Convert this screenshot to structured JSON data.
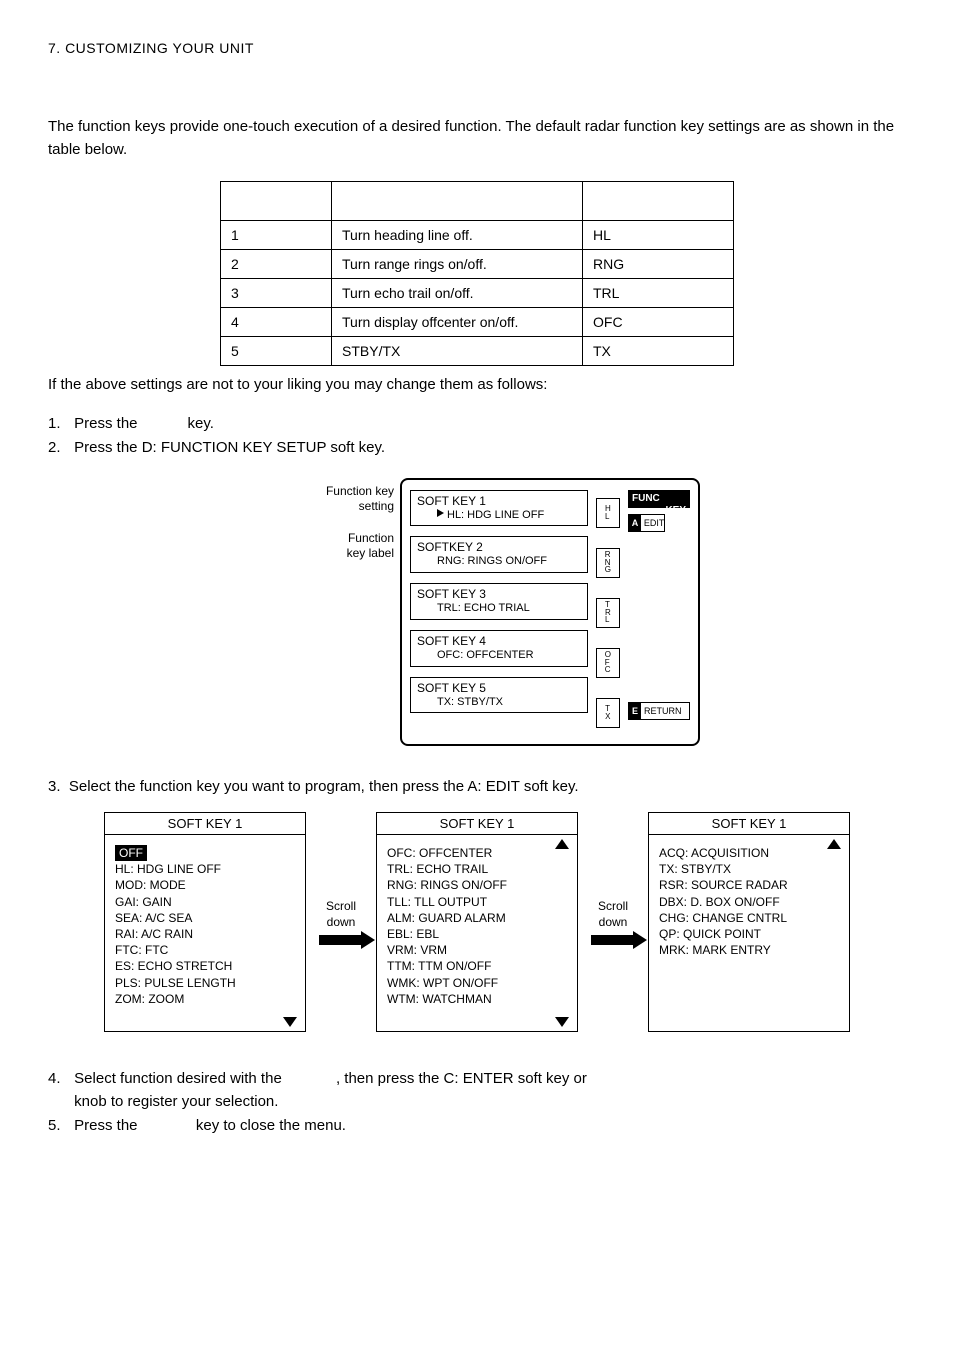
{
  "page_header": "7. CUSTOMIZING YOUR UNIT",
  "intro": "The function keys provide one-touch execution of a desired function. The default radar function key settings are as shown in the table below.",
  "table": {
    "rows": [
      {
        "key": "1",
        "func": "Turn heading line off.",
        "label": "HL"
      },
      {
        "key": "2",
        "func": "Turn range rings on/off.",
        "label": "RNG"
      },
      {
        "key": "3",
        "func": "Turn echo trail on/off.",
        "label": "TRL"
      },
      {
        "key": "4",
        "func": "Turn display offcenter on/off.",
        "label": "OFC"
      },
      {
        "key": "5",
        "func": "STBY/TX",
        "label": "TX"
      }
    ]
  },
  "after_table": "If the above settings are not to your liking you may change them as follows:",
  "steps_a": [
    {
      "idx": "1.",
      "prefix": "Press the ",
      "suffix": " key."
    },
    {
      "idx": "2.",
      "prefix": "Press the D: FUNCTION KEY SETUP soft key.",
      "suffix": ""
    }
  ],
  "fig1": {
    "left_note_1a": "Function key",
    "left_note_1b": "setting",
    "left_note_2a": "Function",
    "left_note_2b": "key label",
    "menu": [
      {
        "title": "SOFT KEY 1",
        "sub": "HL: HDG LINE OFF",
        "badge": "HL"
      },
      {
        "title": "SOFTKEY 2",
        "sub": "RNG: RINGS ON/OFF",
        "badge": "RNG"
      },
      {
        "title": "SOFT KEY 3",
        "sub": "TRL: ECHO TRIAL",
        "badge": "TRL"
      },
      {
        "title": "SOFT KEY 4",
        "sub": "OFC: OFFCENTER",
        "badge": "OFC"
      },
      {
        "title": "SOFT KEY 5",
        "sub": "TX: STBY/TX",
        "badge": "TX"
      }
    ],
    "side_title_l1": "FUNC",
    "side_title_l2": "KEY",
    "softkeys": [
      {
        "letter": "A",
        "label": "EDIT"
      },
      {
        "letter": "E",
        "label": "RETURN"
      }
    ]
  },
  "step3": {
    "idx": "3.",
    "text": "Select the function key you want to program, then press the A: EDIT soft key."
  },
  "fig2": {
    "panels": [
      {
        "title": "SOFT KEY 1",
        "has_up": false,
        "has_down": true,
        "hl_off": "OFF",
        "items": [
          "HL: HDG LINE OFF",
          "MOD: MODE",
          "GAI: GAIN",
          "SEA: A/C SEA",
          "RAI: A/C RAIN",
          "FTC: FTC",
          "ES: ECHO STRETCH",
          "PLS: PULSE LENGTH",
          "ZOM: ZOOM"
        ]
      },
      {
        "title": "SOFT KEY 1",
        "has_up": true,
        "has_down": true,
        "hl_off": null,
        "items": [
          "OFC: OFFCENTER",
          "TRL: ECHO TRAIL",
          "RNG: RINGS ON/OFF",
          "TLL: TLL OUTPUT",
          "ALM: GUARD ALARM",
          "EBL: EBL",
          "VRM: VRM",
          "TTM: TTM ON/OFF",
          "WMK: WPT ON/OFF",
          "WTM: WATCHMAN"
        ]
      },
      {
        "title": "SOFT KEY 1",
        "has_up": true,
        "has_down": false,
        "hl_off": null,
        "items": [
          "ACQ: ACQUISITION",
          "TX: STBY/TX",
          "RSR: SOURCE RADAR",
          "DBX: D. BOX ON/OFF",
          "CHG: CHANGE CNTRL",
          "QP: QUICK POINT",
          "MRK: MARK ENTRY"
        ]
      }
    ],
    "scroll_label_1": "Scroll",
    "scroll_label_2": "down"
  },
  "steps_b": [
    {
      "idx": "4.",
      "line_a": "Select function desired with the ",
      "line_a2": ", then press the C: ENTER soft key or",
      "line_b": "knob to register your selection."
    },
    {
      "idx": "5.",
      "line_a": "Press the ",
      "line_a2": " key to close the menu.",
      "line_b": ""
    }
  ]
}
